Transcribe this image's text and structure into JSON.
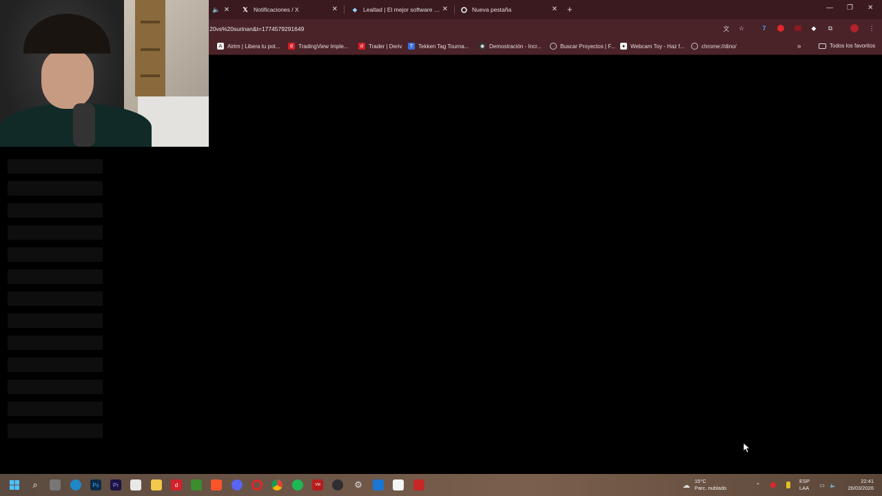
{
  "browser": {
    "tabs": [
      {
        "label": "Notificaciones / X",
        "icon": "x-logo-icon"
      },
      {
        "label": "Lealtad | El mejor software para",
        "icon": "lealtad-icon"
      },
      {
        "label": "Nueva pestaña",
        "icon": "chrome-icon"
      }
    ],
    "url": "20vs%20surinan&t=1774579291649",
    "bookmarks": [
      {
        "label": "Airtm | Libera tu pot...",
        "color": "#f0f0f0"
      },
      {
        "label": "TradingView Imple...",
        "color": "#d6202a"
      },
      {
        "label": "Trader | Deriv",
        "color": "#d6202a"
      },
      {
        "label": "Tekken Tag Tourna...",
        "color": "#3b6fd8"
      },
      {
        "label": "Demostración - Incr...",
        "color": "#333333"
      },
      {
        "label": "Buscar Proyectos | F...",
        "color": "#cfcfcf"
      },
      {
        "label": "Webcam Toy - Haz f...",
        "color": "#f0f0f0"
      },
      {
        "label": "chrome://dino/",
        "color": "#cfcfcf"
      }
    ],
    "bookmarks_all": "Todos los favoritos"
  },
  "taskbar": {
    "weather_temp": "15°C",
    "weather_desc": "Parc. nublado",
    "lang_1": "ESP",
    "lang_2": "LAA",
    "time": "22:41",
    "date": "26/03/2026"
  }
}
